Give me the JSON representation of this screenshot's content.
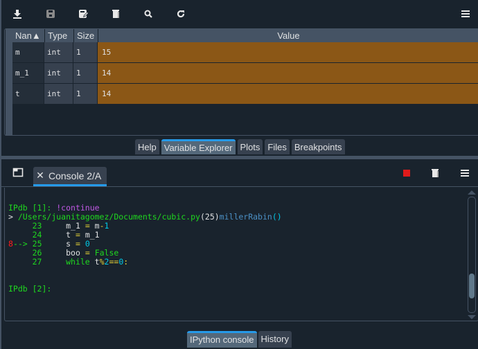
{
  "variable_explorer": {
    "toolbar": {
      "import_label": "import-data",
      "save_label": "save-data",
      "save_as_label": "save-data-as",
      "remove_all_label": "remove-all-variables",
      "search_label": "search-variables",
      "refresh_label": "refresh",
      "options_label": "options-menu"
    },
    "columns": [
      "Nan▲",
      "Type",
      "Size",
      "Value"
    ],
    "rows": [
      {
        "name": "m",
        "type": "int",
        "size": "1",
        "value": "15"
      },
      {
        "name": "m_1",
        "type": "int",
        "size": "1",
        "value": "14"
      },
      {
        "name": "t",
        "type": "int",
        "size": "1",
        "value": "14"
      }
    ],
    "value_highlight_color": "#8b5716"
  },
  "upper_tabs": [
    {
      "label": "Help",
      "active": false
    },
    {
      "label": "Variable Explorer",
      "active": true
    },
    {
      "label": "Plots",
      "active": false
    },
    {
      "label": "Files",
      "active": false
    },
    {
      "label": "Breakpoints",
      "active": false
    }
  ],
  "console": {
    "tab_label": "Console 2/A",
    "tab_close": "✕",
    "lines": {
      "l1_prompt": "IPdb [1]: ",
      "l1_cmd": "!continue",
      "l2_arrow": "> ",
      "l2_path": "/Users/juanitagomez/Documents/cubic.py",
      "l2_lineno": "(25)",
      "l2_func": "millerRabin",
      "l2_parens": "()",
      "code": [
        {
          "marker": "    ",
          "lineno": "23",
          "code": "m_1 = m-1"
        },
        {
          "marker": "    ",
          "lineno": "24",
          "code": "t = m_1"
        },
        {
          "marker": "8--> ",
          "lineno": "25",
          "code": "s = 0"
        },
        {
          "marker": "    ",
          "lineno": "26",
          "code": "boo = False"
        },
        {
          "marker": "    ",
          "lineno": "27",
          "code": "while t%2==0:"
        }
      ],
      "l_prompt2": "IPdb [2]:"
    },
    "stop_color": "#e01b1b"
  },
  "lower_tabs": [
    {
      "label": "IPython console",
      "active": true
    },
    {
      "label": "History",
      "active": false
    }
  ],
  "accent_color": "#259ae9"
}
